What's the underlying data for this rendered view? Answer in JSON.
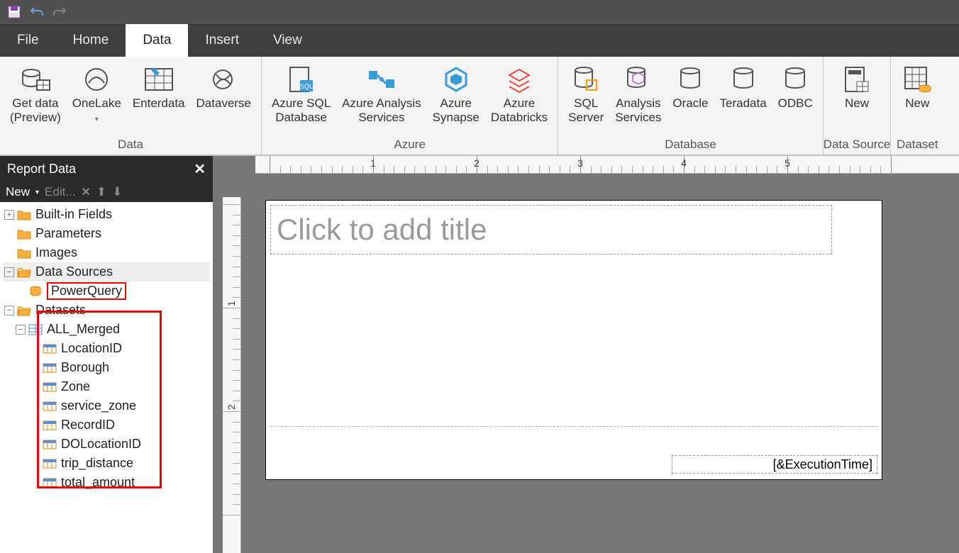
{
  "qat": {
    "save": "save",
    "undo": "undo",
    "redo": "redo"
  },
  "tabs": {
    "file": "File",
    "home": "Home",
    "data": "Data",
    "insert": "Insert",
    "view": "View"
  },
  "ribbon": {
    "groups": {
      "data": {
        "label": "Data",
        "items": {
          "getdata": {
            "l1": "Get data",
            "l2": "(Preview)"
          },
          "onelake": {
            "l1": "OneLake",
            "l2": ""
          },
          "enterdata": {
            "l1": "Enterdata",
            "l2": ""
          },
          "dataverse": {
            "l1": "Dataverse",
            "l2": ""
          }
        }
      },
      "azure": {
        "label": "Azure",
        "items": {
          "azuresql": {
            "l1": "Azure SQL",
            "l2": "Database"
          },
          "azureas": {
            "l1": "Azure Analysis",
            "l2": "Services"
          },
          "synapse": {
            "l1": "Azure",
            "l2": "Synapse"
          },
          "databricks": {
            "l1": "Azure",
            "l2": "Databricks"
          }
        }
      },
      "database": {
        "label": "Database",
        "items": {
          "sqlserver": {
            "l1": "SQL",
            "l2": "Server"
          },
          "as": {
            "l1": "Analysis",
            "l2": "Services"
          },
          "oracle": {
            "l1": "Oracle",
            "l2": ""
          },
          "teradata": {
            "l1": "Teradata",
            "l2": ""
          },
          "odbc": {
            "l1": "ODBC",
            "l2": ""
          }
        }
      },
      "datasource": {
        "label": "Data Source",
        "items": {
          "new": {
            "l1": "New",
            "l2": ""
          }
        }
      },
      "dataset": {
        "label": "Dataset",
        "items": {
          "new": {
            "l1": "New",
            "l2": ""
          }
        }
      }
    }
  },
  "panel": {
    "title": "Report Data",
    "new": "New",
    "edit": "Edit...",
    "tree": {
      "builtin": "Built-in Fields",
      "parameters": "Parameters",
      "images": "Images",
      "datasources": "Data Sources",
      "ds_items": {
        "powerquery": "PowerQuery"
      },
      "datasets": "Datasets",
      "dset_items": {
        "allmerged": "ALL_Merged",
        "fields": {
          "locationid": "LocationID",
          "borough": "Borough",
          "zone": "Zone",
          "service_zone": "service_zone",
          "recordid": "RecordID",
          "dolocationid": "DOLocationID",
          "trip_distance": "trip_distance",
          "total_amount": "total_amount"
        }
      }
    }
  },
  "designer": {
    "title_placeholder": "Click to add title",
    "exec_time": "[&ExecutionTime]",
    "ruler_marks": {
      "r1": "1",
      "r2": "2",
      "r3": "3",
      "r4": "4",
      "r5": "5"
    },
    "vruler": {
      "v1": "1",
      "v2": "2"
    }
  },
  "colors": {
    "highlight": "#e10600"
  }
}
